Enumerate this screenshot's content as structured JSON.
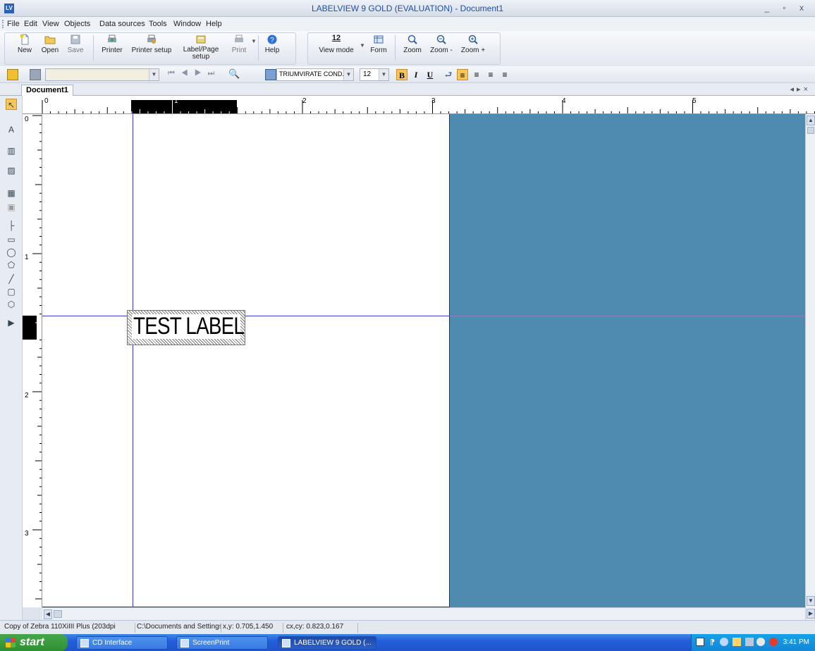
{
  "window": {
    "title": "LABELVIEW 9 GOLD (EVALUATION) - Document1",
    "controls": "_ ▫ x"
  },
  "menu": [
    "File",
    "Edit",
    "View",
    "Objects",
    "Data sources",
    "Tools",
    "Window",
    "Help"
  ],
  "toolbar1": {
    "buttons": [
      {
        "label": "New",
        "icon": "new-document-icon"
      },
      {
        "label": "Open",
        "icon": "open-folder-icon"
      },
      {
        "label": "Save",
        "icon": "save-disk-icon"
      },
      {
        "label": "Printer",
        "icon": "printer-icon"
      },
      {
        "label": "Printer setup",
        "icon": "printer-setup-icon"
      },
      {
        "label": "Label/Page setup",
        "icon": "page-setup-icon"
      },
      {
        "label": "Print",
        "icon": "print-icon"
      },
      {
        "label": "Help",
        "icon": "help-icon"
      },
      {
        "label": "View mode",
        "icon": "view-mode-icon"
      },
      {
        "label": "Form",
        "icon": "form-icon"
      },
      {
        "label": "Zoom",
        "icon": "zoom-icon"
      },
      {
        "label": "Zoom -",
        "icon": "zoom-out-icon"
      },
      {
        "label": "Zoom +",
        "icon": "zoom-in-icon"
      }
    ],
    "view_mode_value": "12"
  },
  "toolbar2": {
    "font_name": "TRIUMVIRATE COND.",
    "font_size": "12",
    "bold": "B",
    "italic": "I",
    "underline": "U"
  },
  "document_tab": "Document1",
  "rulers": {
    "horizontal": [
      "0",
      "1",
      "2",
      "3",
      "4",
      "5"
    ],
    "vertical": [
      "0",
      "1",
      "2",
      "3"
    ]
  },
  "label": {
    "text": "TEST LABEL"
  },
  "status": {
    "printer": "Copy of Zebra 110XiIII Plus (203dpi",
    "path": "C:\\Documents and Settings",
    "xy": "x,y: 0.705,1.450",
    "cxcy": "cx,cy: 0.823,0.167"
  },
  "taskbar": {
    "start": "start",
    "tasks": [
      "CD Interface",
      "ScreenPrint",
      "LABELVIEW 9 GOLD (..."
    ],
    "clock": "3:41 PM"
  },
  "colors": {
    "workspace": "#4f8bb0",
    "guide": "#3a3ad6",
    "title_text": "#1f4fa0"
  }
}
